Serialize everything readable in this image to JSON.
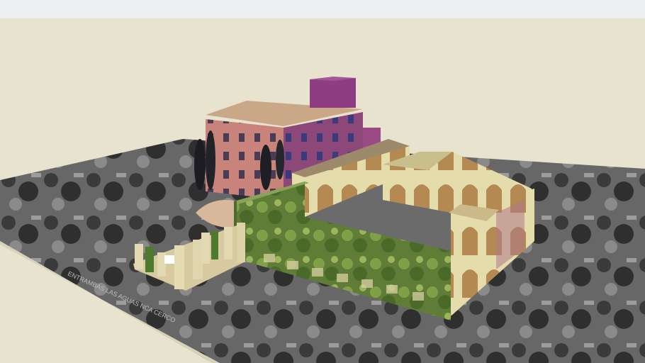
{
  "scene": {
    "title": "",
    "colors": {
      "sky": "#e6e1cc",
      "top_strip": "#eef1f3",
      "ground_base": "#5f5f5f",
      "palace_pink": "#c9857a",
      "palace_roof": "#c9a98a",
      "palace_side_purple": "#8e4a7a",
      "tower_purple": "#8f3d82",
      "garden_wall_green": "#6c8a3e",
      "arcade_cream": "#e7ddb0",
      "courtyard_gray": "#6b6b6b"
    },
    "ground_caption": "ENTRAMBAS LAS AGUAS NCA CERCO"
  }
}
